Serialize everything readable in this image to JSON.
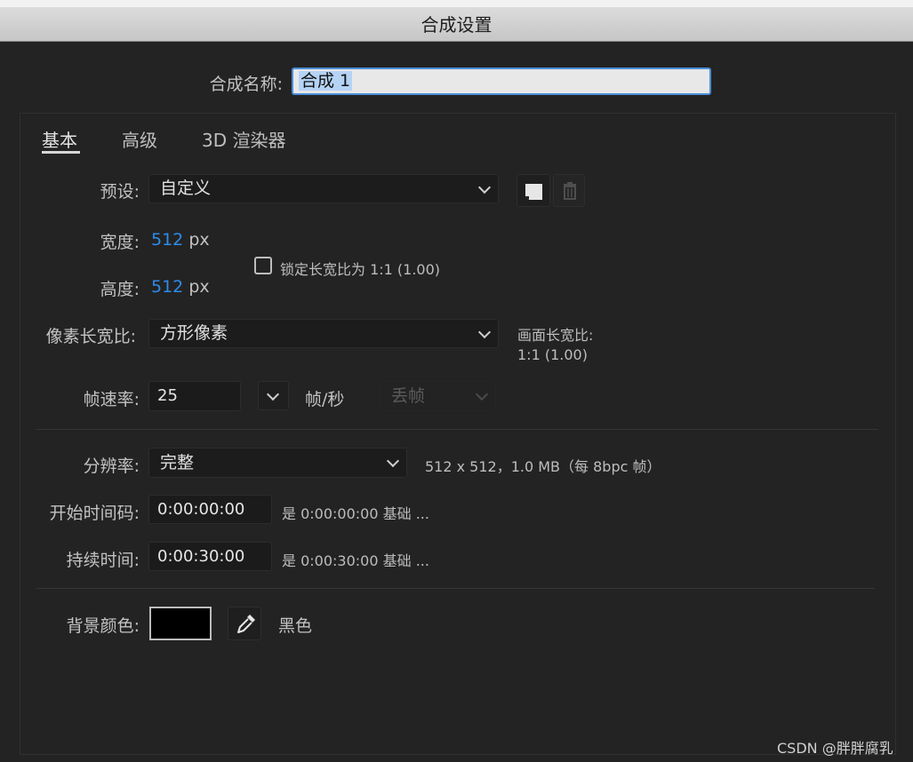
{
  "window": {
    "title": "合成设置"
  },
  "comp_name": {
    "label": "合成名称:",
    "value": "合成 1"
  },
  "tabs": [
    {
      "label": "基本",
      "active": true
    },
    {
      "label": "高级",
      "active": false
    },
    {
      "label": "3D 渲染器",
      "active": false
    }
  ],
  "preset": {
    "label": "预设:",
    "value": "自定义",
    "save_icon": "save-preset-icon",
    "delete_icon": "trash-icon"
  },
  "width": {
    "label": "宽度:",
    "value": "512",
    "unit": "px"
  },
  "height": {
    "label": "高度:",
    "value": "512",
    "unit": "px"
  },
  "lock_aspect": {
    "label": "锁定长宽比为 1:1 (1.00)",
    "checked": false
  },
  "pixel_aspect": {
    "label": "像素长宽比:",
    "value": "方形像素"
  },
  "frame_aspect": {
    "label": "画面长宽比:",
    "value": "1:1 (1.00)"
  },
  "frame_rate": {
    "label": "帧速率:",
    "value": "25",
    "unit": "帧/秒",
    "drop_frame": "丢帧"
  },
  "resolution": {
    "label": "分辨率:",
    "value": "完整",
    "info": "512 x 512，1.0 MB（每 8bpc 帧）"
  },
  "start_timecode": {
    "label": "开始时间码:",
    "value": "0:00:00:00",
    "note": "是 0:00:00:00  基础 ..."
  },
  "duration": {
    "label": "持续时间:",
    "value": "0:00:30:00",
    "note": "是 0:00:30:00  基础 ..."
  },
  "background": {
    "label": "背景颜色:",
    "color": "#000000",
    "color_name": "黑色",
    "eyedropper_icon": "eyedropper-icon"
  },
  "watermark": "CSDN @胖胖腐乳",
  "colors": {
    "accent_blue": "#2d8ceb",
    "panel_bg": "#232323",
    "title_bg": "#cfcfcf"
  }
}
